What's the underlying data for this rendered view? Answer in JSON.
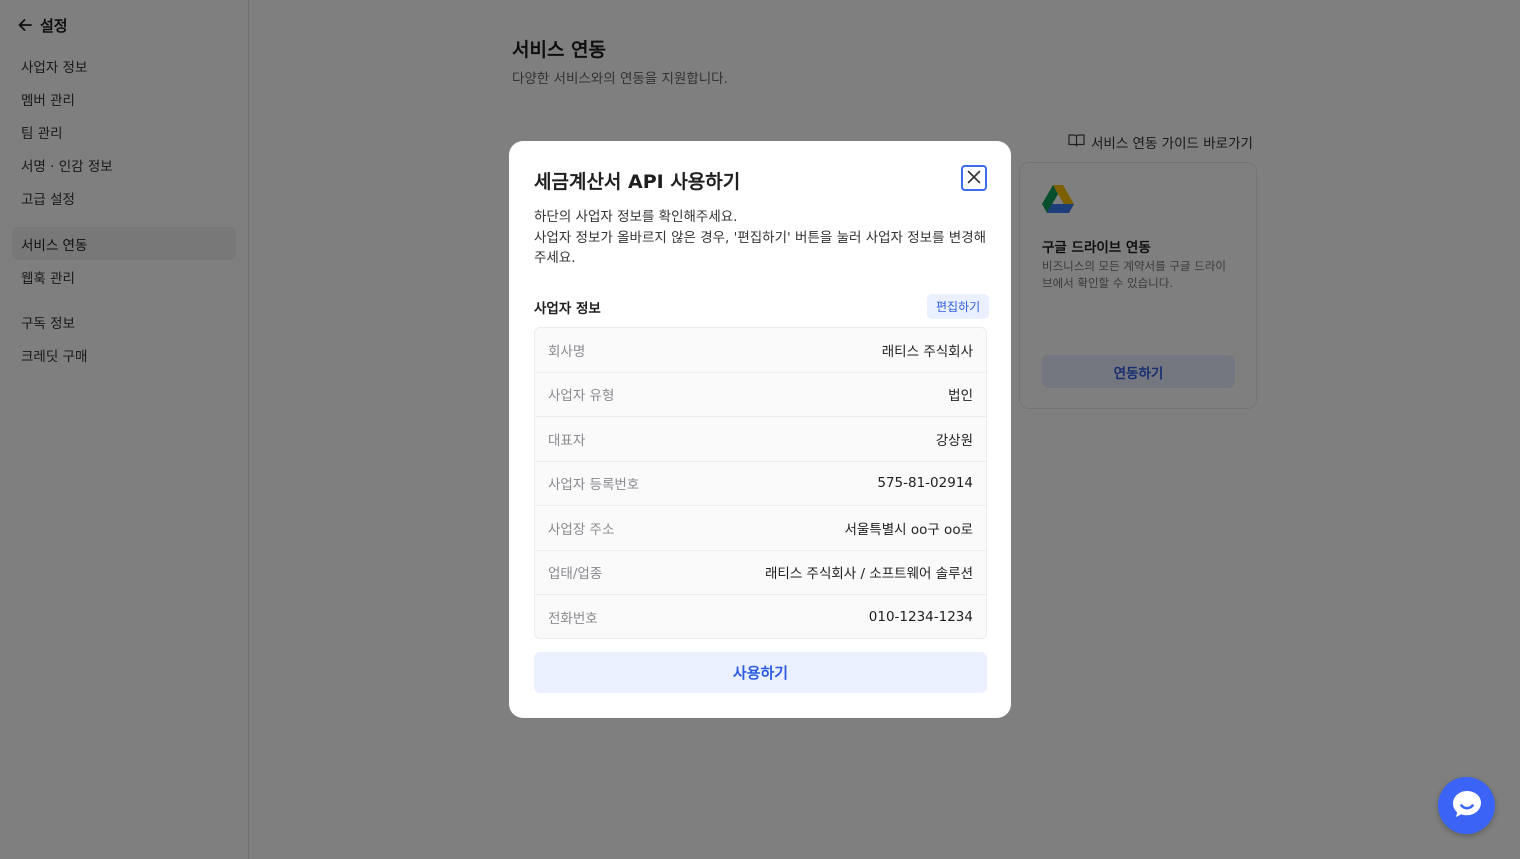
{
  "sidebar": {
    "header_title": "설정",
    "items": [
      {
        "label": "사업자 정보"
      },
      {
        "label": "멤버 관리"
      },
      {
        "label": "팀 관리"
      },
      {
        "label": "서명 · 인감 정보"
      },
      {
        "label": "고급 설정"
      },
      {
        "label": "서비스 연동",
        "active": true
      },
      {
        "label": "웹훅 관리"
      },
      {
        "label": "구독 정보"
      },
      {
        "label": "크레딧 구매"
      }
    ]
  },
  "main": {
    "title": "서비스 연동",
    "subtitle": "다양한 서비스와의 연동을 지원합니다.",
    "guide_link": "서비스 연동 가이드 바로가기",
    "card": {
      "icon": "google-drive-icon",
      "title": "구글 드라이브 연동",
      "description": "비즈니스의 모든 계약서를 구글 드라이브에서 확인할 수 있습니다.",
      "button": "연동하기"
    }
  },
  "modal": {
    "title": "세금계산서 API 사용하기",
    "desc_line1": "하단의 사업자 정보를 확인해주세요.",
    "desc_line2": "사업자 정보가 올바르지 않은 경우, '편집하기' 버튼을 눌러 사업자 정보를 변경해주세요.",
    "section_title": "사업자 정보",
    "edit_button": "편집하기",
    "rows": [
      {
        "label": "회사명",
        "value": "래티스 주식회사"
      },
      {
        "label": "사업자 유형",
        "value": "법인"
      },
      {
        "label": "대표자",
        "value": "강상원"
      },
      {
        "label": "사업자 등록번호",
        "value": "575-81-02914"
      },
      {
        "label": "사업장 주소",
        "value": "서울특별시 oo구 oo로"
      },
      {
        "label": "업태/업종",
        "value": "래티스 주식회사 / 소프트웨어 솔루션"
      },
      {
        "label": "전화번호",
        "value": "010-1234-1234"
      }
    ],
    "primary_button": "사용하기"
  },
  "colors": {
    "accent": "#3b63f5",
    "accent_text": "#2f5ce0",
    "accent_soft": "#eaf0ff",
    "overlay": "rgba(0,0,0,0.5)"
  }
}
